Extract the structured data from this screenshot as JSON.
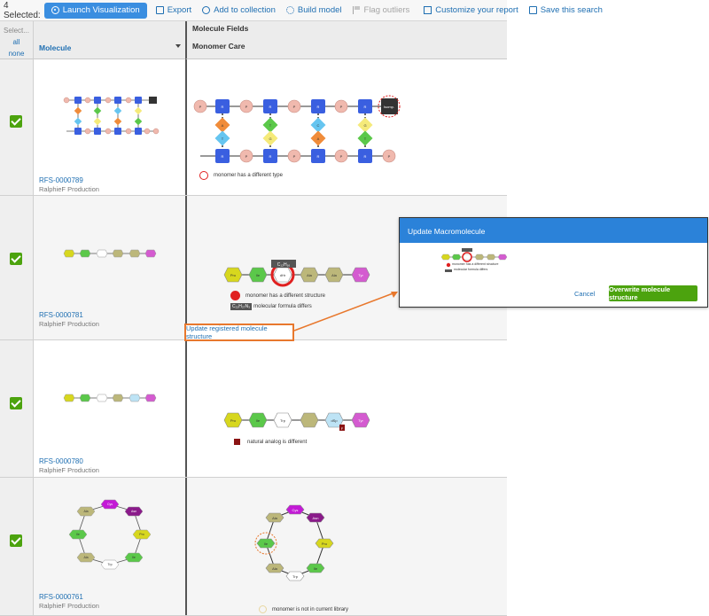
{
  "toolbar": {
    "selected_count": "4 Selected:",
    "launch": "Launch Visualization",
    "export": "Export",
    "add_collection": "Add to collection",
    "build_model": "Build model",
    "flag_outliers": "Flag outliers",
    "customize": "Customize your report",
    "save_search": "Save this search"
  },
  "header": {
    "select_label": "Select...",
    "select_all": "all",
    "select_none": "none",
    "molecule": "Molecule",
    "fields_title": "Molecule Fields",
    "fields_sub": "Monomer Care"
  },
  "rows": [
    {
      "id": "RFS-0000789",
      "source": "RalphieF Production",
      "legend": "monomer has a different type",
      "special_label": "Isomp."
    },
    {
      "id": "RFS-0000781",
      "source": "RalphieF Production",
      "legend1": "monomer has a different structure",
      "legend2": "molecular formula differs",
      "badge": "C₁₂H₁₆",
      "formula_tag": "C₂₁H₂₇N₃"
    },
    {
      "id": "RFS-0000780",
      "source": "RalphieF Production",
      "legend": "natural analog is different"
    },
    {
      "id": "RFS-0000761",
      "source": "RalphieF Production",
      "legend": "monomer is not in current library"
    }
  ],
  "update_link": "Update registered molecule structure",
  "dialog": {
    "title": "Update Macromolecule",
    "cancel": "Cancel",
    "overwrite": "Overwrite molecule structure",
    "legend1": "monomer has a different structure",
    "legend2": "molecular formula differs"
  },
  "monomers": {
    "pro": "Pro",
    "ile": "Ile",
    "trp": "Trp",
    "ala": "Ala",
    "tyr": "Tyr",
    "gln": "Gln",
    "cys": "Cys",
    "asn": "Asn",
    "thr": "Thr",
    "leu": "Leu",
    "a": "A",
    "t": "T",
    "g": "G",
    "c": "C",
    "p": "P",
    "r": "R",
    "dhr": "dHr",
    "dsp": "dSp",
    "f": "F"
  },
  "colors": {
    "accent": "#3a8ee0",
    "link": "#1f6fb2",
    "check": "#4ca30e",
    "highlight": "#e8782d",
    "error": "#e02020"
  }
}
